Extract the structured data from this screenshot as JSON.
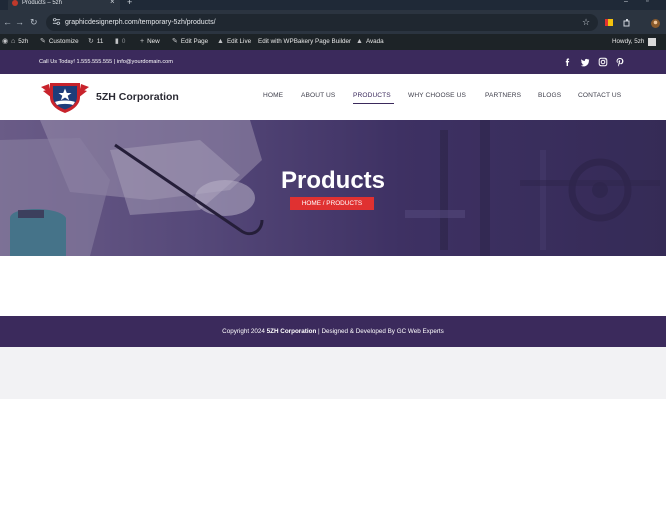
{
  "browser": {
    "tab_title": "Products – 5zh",
    "url": "graphicdesignerph.com/temporary-5zh/products/"
  },
  "adminbar": {
    "site": "5zh",
    "customize": "Customize",
    "updates": "11",
    "comments": "0",
    "new": "New",
    "edit_page": "Edit Page",
    "edit_live": "Edit Live",
    "wpbakery": "Edit with WPBakery Page Builder",
    "avada": "Avada",
    "howdy": "Howdy, 5zh"
  },
  "topbar": {
    "contact": "Call Us Today! 1.555.555.555 | info@yourdomain.com",
    "social": [
      "facebook-icon",
      "twitter-icon",
      "instagram-icon",
      "pinterest-icon"
    ]
  },
  "header": {
    "brand": "5ZH Corporation",
    "menu": [
      "HOME",
      "ABOUT US",
      "PRODUCTS",
      "WHY CHOOSE US",
      "PARTNERS",
      "BLOGS",
      "CONTACT US"
    ],
    "active": "PRODUCTS"
  },
  "hero": {
    "title": "Products",
    "breadcrumb": "HOME / PRODUCTS"
  },
  "footer": {
    "prefix": "Copyright 2024 ",
    "company": "5ZH Corporation",
    "suffix": " | Designed & Developed By GC Web Experts"
  },
  "colors": {
    "brand_purple": "#3b2a5c",
    "accent_red": "#e03131",
    "admin_bar": "#1d2327"
  }
}
